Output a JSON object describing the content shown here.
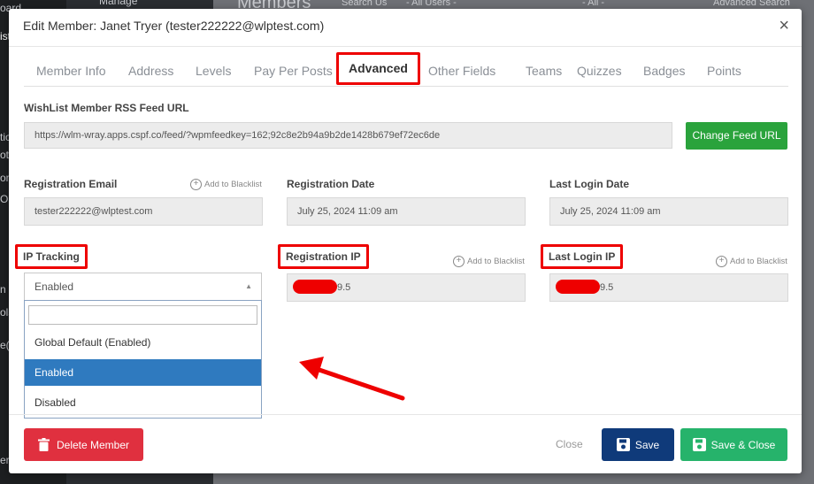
{
  "background": {
    "sidebar_items": [
      "oard",
      "ist",
      "tio",
      "ot",
      "om",
      "Op",
      "n",
      "ols",
      "e(",
      "er"
    ],
    "top_texts": [
      "Manage",
      "Members",
      "Search Us",
      "- All Users -",
      "- All -",
      "Advanced Search"
    ]
  },
  "modal": {
    "title": "Edit Member: Janet Tryer (tester222222@wlptest.com)",
    "close_glyph": "×"
  },
  "tabs": [
    {
      "label": "Member Info"
    },
    {
      "label": "Address"
    },
    {
      "label": "Levels"
    },
    {
      "label": "Pay Per Posts"
    },
    {
      "label": "Advanced",
      "active": true
    },
    {
      "label": "Other Fields"
    },
    {
      "label": "Teams"
    },
    {
      "label": "Quizzes"
    },
    {
      "label": "Badges"
    },
    {
      "label": "Points"
    }
  ],
  "rss": {
    "label": "WishList Member RSS Feed URL",
    "url": "https://wlm-wray.apps.cspf.co/feed/?wpmfeedkey=162;92c8e2b94a9b2de1428b679ef72ec6de",
    "button": "Change Feed URL"
  },
  "fields": {
    "registration_email": {
      "label": "Registration Email",
      "value": "tester222222@wlptest.com",
      "blacklist": "Add to Blacklist"
    },
    "registration_date": {
      "label": "Registration Date",
      "value": "July 25, 2024 11:09 am"
    },
    "last_login_date": {
      "label": "Last Login Date",
      "value": "July 25, 2024 11:09 am"
    },
    "ip_tracking": {
      "label": "IP Tracking",
      "value": "Enabled"
    },
    "registration_ip": {
      "label": "Registration IP",
      "value_suffix": "9.5",
      "blacklist": "Add to Blacklist"
    },
    "last_login_ip": {
      "label": "Last Login IP",
      "value_suffix": "9.5",
      "blacklist": "Add to Blacklist"
    }
  },
  "dropdown": {
    "options": [
      "Global Default (Enabled)",
      "Enabled",
      "Disabled"
    ],
    "selected": "Enabled"
  },
  "footer": {
    "delete": "Delete Member",
    "close": "Close",
    "save": "Save",
    "save_close": "Save & Close"
  },
  "colors": {
    "highlight": "#e00000",
    "green": "#2aa33c",
    "delete": "#e0303f",
    "save": "#0f3a7a",
    "save_close": "#26b36b",
    "selected_option": "#2f7abf"
  }
}
